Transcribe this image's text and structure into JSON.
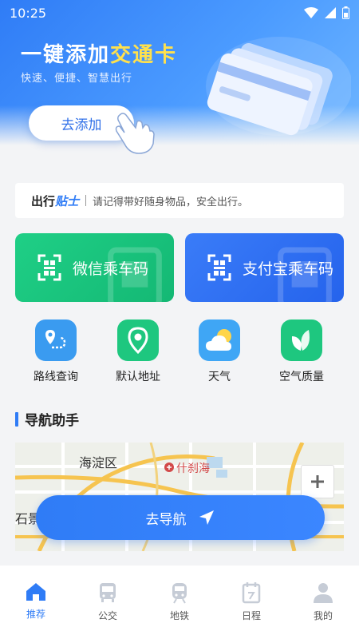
{
  "status": {
    "time": "10:25"
  },
  "hero": {
    "title_a": "一键添加",
    "title_b": "交通卡",
    "subtitle": "快速、便捷、智慧出行",
    "add_button": "去添加"
  },
  "tip": {
    "label_a": "出行",
    "label_b": "贴士",
    "text": "请记得带好随身物品，安全出行。"
  },
  "codes": {
    "wechat": "微信乘车码",
    "alipay": "支付宝乘车码"
  },
  "tools": [
    {
      "label": "路线查询",
      "icon": "route-icon",
      "color": "#3a9bf0"
    },
    {
      "label": "默认地址",
      "icon": "location-pin-icon",
      "color": "#1ec77f"
    },
    {
      "label": "天气",
      "icon": "weather-icon",
      "color": "#3fa6f5"
    },
    {
      "label": "空气质量",
      "icon": "leaf-icon",
      "color": "#1ec77f"
    }
  ],
  "nav_helper": {
    "title": "导航助手",
    "map_labels": {
      "district": "海淀区",
      "poi": "什刹海",
      "left": "石景"
    },
    "nav_button": "去导航"
  },
  "tabbar": [
    {
      "label": "推荐",
      "icon": "home-icon",
      "active": true
    },
    {
      "label": "公交",
      "icon": "bus-icon",
      "active": false
    },
    {
      "label": "地铁",
      "icon": "subway-icon",
      "active": false
    },
    {
      "label": "日程",
      "icon": "calendar-icon",
      "active": false
    },
    {
      "label": "我的",
      "icon": "profile-icon",
      "active": false
    }
  ],
  "colors": {
    "accent": "#2f7cf6",
    "wechat": "#1ec77f",
    "highlight": "#ffe14d"
  }
}
